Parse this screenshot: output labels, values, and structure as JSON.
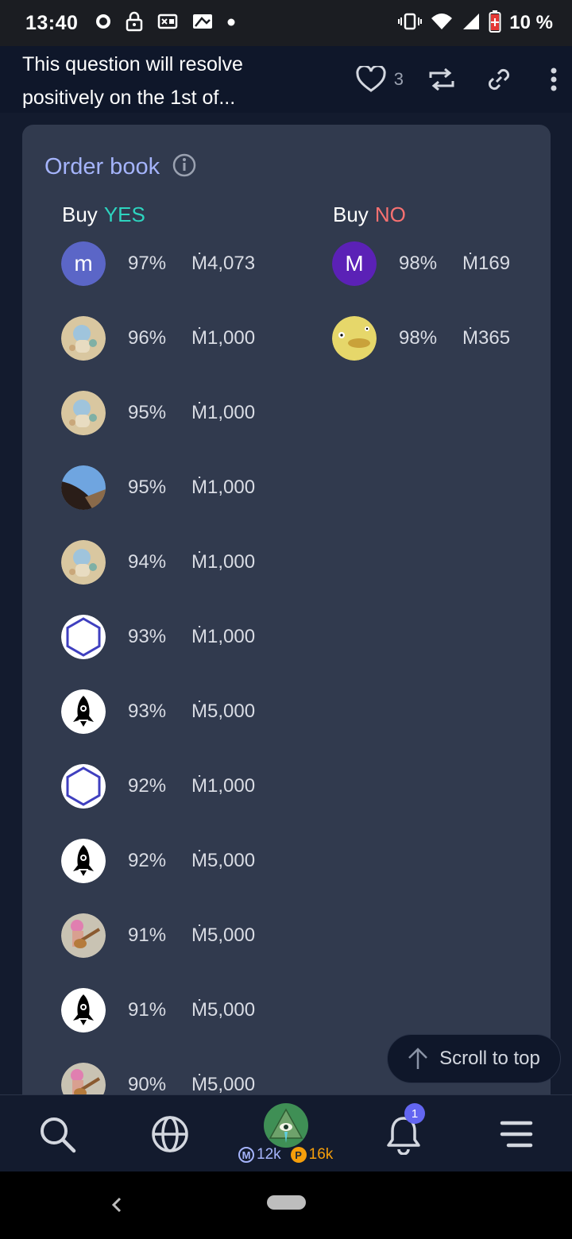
{
  "status_bar": {
    "time": "13:40",
    "battery": "10 %"
  },
  "header": {
    "question": "This question will resolve positively on the 1st of...",
    "like_count": "3"
  },
  "order_book": {
    "title": "Order book",
    "yes_column": {
      "buy_label": "Buy",
      "outcome_label": "YES"
    },
    "no_column": {
      "buy_label": "Buy",
      "outcome_label": "NO"
    },
    "yes_orders": [
      {
        "avatar": "letter-m-avatar",
        "avatar_letter": "m",
        "prob": "97%",
        "amount": "Ṁ4,073"
      },
      {
        "avatar": "anime-girl-avatar",
        "prob": "96%",
        "amount": "Ṁ1,000"
      },
      {
        "avatar": "anime-girl-avatar",
        "prob": "95%",
        "amount": "Ṁ1,000"
      },
      {
        "avatar": "landscape-avatar",
        "prob": "95%",
        "amount": "Ṁ1,000"
      },
      {
        "avatar": "anime-girl-avatar",
        "prob": "94%",
        "amount": "Ṁ1,000"
      },
      {
        "avatar": "hexagon-avatar",
        "prob": "93%",
        "amount": "Ṁ1,000"
      },
      {
        "avatar": "rocket-avatar",
        "prob": "93%",
        "amount": "Ṁ5,000"
      },
      {
        "avatar": "hexagon-avatar",
        "prob": "92%",
        "amount": "Ṁ1,000"
      },
      {
        "avatar": "rocket-avatar",
        "prob": "92%",
        "amount": "Ṁ5,000"
      },
      {
        "avatar": "guitarist-avatar",
        "prob": "91%",
        "amount": "Ṁ5,000"
      },
      {
        "avatar": "rocket-avatar",
        "prob": "91%",
        "amount": "Ṁ5,000"
      },
      {
        "avatar": "guitarist-avatar",
        "prob": "90%",
        "amount": "Ṁ5,000"
      }
    ],
    "no_orders": [
      {
        "avatar": "letter-m-avatar",
        "avatar_letter": "M",
        "prob": "98%",
        "amount": "Ṁ169"
      },
      {
        "avatar": "duck-avatar",
        "prob": "98%",
        "amount": "Ṁ365"
      }
    ]
  },
  "scroll_to_top": {
    "label": "Scroll to top"
  },
  "bottom_nav": {
    "mana_balance": "12k",
    "prize_balance": "16k",
    "notification_count": "1",
    "mana_coin_letter": "M",
    "prize_coin_letter": "P"
  },
  "colors": {
    "yes": "#2dd4bf",
    "no": "#f87171",
    "accent": "#a5b4fc",
    "card": "#313a4e",
    "header": "#0f172a"
  }
}
